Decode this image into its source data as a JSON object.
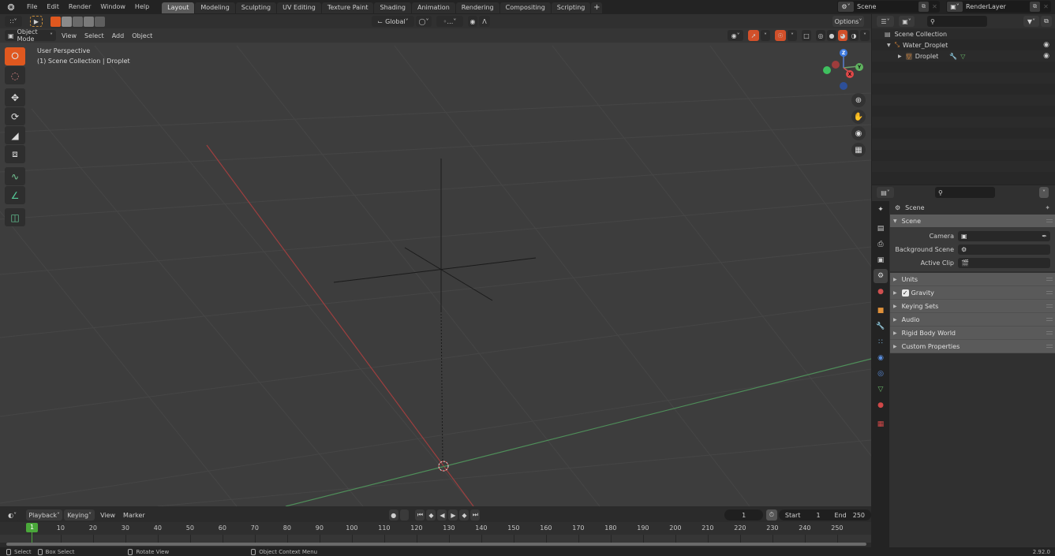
{
  "topbar": {
    "menus": [
      "File",
      "Edit",
      "Render",
      "Window",
      "Help"
    ],
    "workspaces": [
      "Layout",
      "Modeling",
      "Sculpting",
      "UV Editing",
      "Texture Paint",
      "Shading",
      "Animation",
      "Rendering",
      "Compositing",
      "Scripting"
    ],
    "active_workspace": "Layout",
    "add_workspace": "+",
    "scene": "Scene",
    "view_layer": "RenderLayer"
  },
  "viewport": {
    "mode": "Object Mode",
    "menus": [
      "View",
      "Select",
      "Add",
      "Object"
    ],
    "orientation": "Global",
    "options_label": "Options",
    "overlay_line1": "User Perspective",
    "overlay_line2": "(1) Scene Collection | Droplet",
    "tools": [
      "select-box",
      "cursor",
      "move",
      "rotate",
      "scale",
      "transform",
      "annotate",
      "measure",
      "add-cube"
    ],
    "gizmo_axes": [
      "Z",
      "Y",
      "X"
    ],
    "nav_buttons": [
      "zoom",
      "pan",
      "camera",
      "perspective-toggle"
    ],
    "axis_colors": {
      "x": "#c54a4a",
      "y": "#5a9b5a",
      "z": "#3f6fc2"
    }
  },
  "timeline": {
    "editor_menus": [
      "Playback",
      "Keying",
      "View",
      "Marker"
    ],
    "current_frame": "1",
    "start_label": "Start",
    "start": "1",
    "end_label": "End",
    "end": "250",
    "playhead": "1",
    "ticks": [
      "10",
      "20",
      "30",
      "40",
      "50",
      "60",
      "70",
      "80",
      "90",
      "100",
      "110",
      "120",
      "130",
      "140",
      "150",
      "160",
      "170",
      "180",
      "190",
      "200",
      "210",
      "220",
      "230",
      "240",
      "250"
    ]
  },
  "statusbar": {
    "items": [
      "Select",
      "Box Select",
      "Rotate View",
      "Object Context Menu"
    ],
    "version": "2.92.0"
  },
  "outliner": {
    "root": "Scene Collection",
    "items": [
      {
        "name": "Water_Droplet",
        "type": "armature",
        "expanded": true
      },
      {
        "name": "Droplet",
        "type": "mesh",
        "expanded": false
      }
    ]
  },
  "properties": {
    "context": "Scene",
    "panel": "Scene",
    "fields": [
      {
        "label": "Camera",
        "value": ""
      },
      {
        "label": "Background Scene",
        "value": ""
      },
      {
        "label": "Active Clip",
        "value": ""
      }
    ],
    "subpanels": [
      "Units",
      "Gravity",
      "Keying Sets",
      "Audio",
      "Rigid Body World",
      "Custom Properties"
    ],
    "gravity_checked": true,
    "tabs": [
      "tool",
      "render",
      "output",
      "view-layer",
      "scene",
      "world",
      "object",
      "modifiers",
      "particles",
      "physics",
      "constraints",
      "data",
      "material",
      "texture"
    ],
    "active_tab": "scene"
  }
}
